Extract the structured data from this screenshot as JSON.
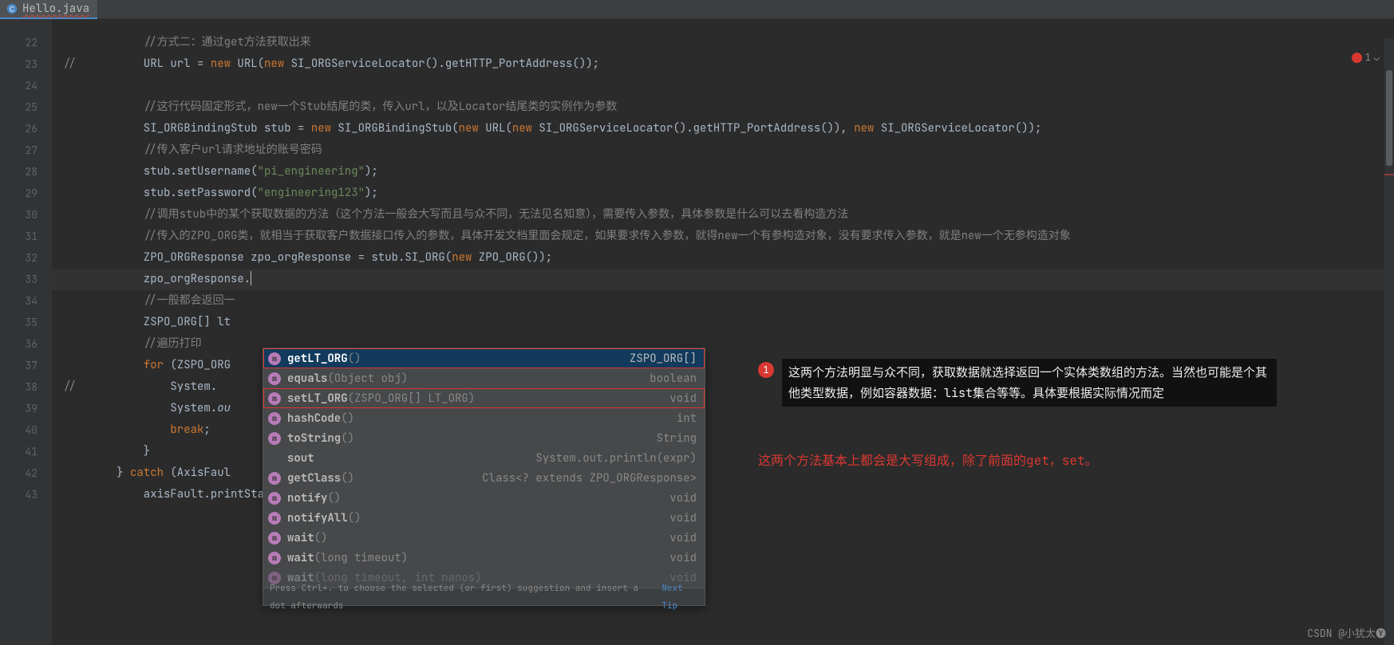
{
  "tab": {
    "filename": "Hello.java"
  },
  "gutter_start": 22,
  "err_count": "1",
  "lines": [
    {
      "n": 22,
      "html": "            <span class='c-comment'>//方式二：通过get方法获取出来</span>"
    },
    {
      "n": 23,
      "html": "<span class='c-comment'>//</span>          URL url = <span class='c-kw'>new</span> URL(<span class='c-kw'>new</span> SI_ORGServiceLocator().getHTTP_PortAddress());"
    },
    {
      "n": 24,
      "html": ""
    },
    {
      "n": 25,
      "html": "            <span class='c-comment'>//这行代码固定形式，new一个Stub结尾的类，传入url，以及Locator结尾类的实例作为参数</span>"
    },
    {
      "n": 26,
      "html": "            SI_ORGBindingStub stub = <span class='c-kw'>new</span> SI_ORGBindingStub(<span class='c-kw'>new</span> URL(<span class='c-kw'>new</span> SI_ORGServiceLocator().getHTTP_PortAddress()), <span class='c-kw'>new</span> SI_ORGServiceLocator());"
    },
    {
      "n": 27,
      "html": "            <span class='c-comment'>//传入客户url请求地址的账号密码</span>"
    },
    {
      "n": 28,
      "html": "            stub.setUsername(<span class='c-str'>\"pi_engineering\"</span>);"
    },
    {
      "n": 29,
      "html": "            stub.setPassword(<span class='c-str'>\"engineering123\"</span>);"
    },
    {
      "n": 30,
      "html": "            <span class='c-comment'>//调用stub中的某个获取数据的方法（这个方法一般会大写而且与众不同，无法见名知意），需要传入参数，具体参数是什么可以去看构造方法</span>"
    },
    {
      "n": 31,
      "html": "            <span class='c-comment'>//传入的ZPO_ORG类，就相当于获取客户数据接口传入的参数，具体开发文档里面会规定，如果要求传入参数，就得new一个有参构造对象，没有要求传入参数，就是new一个无参构造对象</span>"
    },
    {
      "n": 32,
      "html": "            ZPO_ORGResponse zpo_orgResponse = stub.SI_ORG(<span class='c-kw'>new</span> ZPO_ORG());"
    },
    {
      "n": 33,
      "html": "            zpo_orgResponse.<span class='caret'></span>",
      "current": true
    },
    {
      "n": 34,
      "html": "            <span class='c-comment'>//一般都会返回一</span>"
    },
    {
      "n": 35,
      "html": "            ZSPO_ORG[] lt"
    },
    {
      "n": 36,
      "html": "            <span class='c-comment'>//遍历打印</span>"
    },
    {
      "n": 37,
      "html": "            <span class='c-kw'>for</span> (ZSPO_ORG"
    },
    {
      "n": 38,
      "html": "<span class='c-comment'>//</span>              System."
    },
    {
      "n": 39,
      "html": "                System.<span class='c-id' style='font-style:italic'>ou</span>"
    },
    {
      "n": 40,
      "html": "                <span class='c-kw'>break</span>;"
    },
    {
      "n": 41,
      "html": "            }"
    },
    {
      "n": 42,
      "html": "        } <span class='c-kw'>catch</span> (AxisFaul"
    },
    {
      "n": 43,
      "html": "            axisFault.printStackTrace();"
    }
  ],
  "completion": {
    "items": [
      {
        "kind": "m",
        "name": "getLT_ORG",
        "sig": "()",
        "ret": "ZSPO_ORG[]",
        "sel": true
      },
      {
        "kind": "m",
        "name": "equals",
        "sig": "(Object obj)",
        "ret": "boolean"
      },
      {
        "kind": "m",
        "name": "setLT_ORG",
        "sig": "(ZSPO_ORG[] LT_ORG)",
        "ret": "void"
      },
      {
        "kind": "m",
        "name": "hashCode",
        "sig": "()",
        "ret": "int"
      },
      {
        "kind": "m",
        "name": "toString",
        "sig": "()",
        "ret": "String"
      },
      {
        "kind": "",
        "name": "sout",
        "sig": "",
        "ret": "System.out.println(expr)"
      },
      {
        "kind": "m",
        "name": "getClass",
        "sig": "()",
        "ret": "Class<? extends ZPO_ORGResponse>"
      },
      {
        "kind": "m",
        "name": "notify",
        "sig": "()",
        "ret": "void"
      },
      {
        "kind": "m",
        "name": "notifyAll",
        "sig": "()",
        "ret": "void"
      },
      {
        "kind": "m",
        "name": "wait",
        "sig": "()",
        "ret": "void"
      },
      {
        "kind": "m",
        "name": "wait",
        "sig": "(long timeout)",
        "ret": "void"
      },
      {
        "kind": "m",
        "name": "wait",
        "sig": "(long timeout, int nanos)",
        "ret": "void",
        "dim": true
      }
    ],
    "hint_prefix": "Press Ctrl+. to choose the selected (or first) suggestion and insert a dot afterwards",
    "hint_link": "Next Tip"
  },
  "annotation": {
    "badge": "1",
    "text": "这两个方法明显与众不同，获取数据就选择返回一个实体类数组的方法。当然也可能是个其他类型数据，例如容器数据：list集合等等。具体要根据实际情况而定",
    "line2": "这两个方法基本上都会是大写组成，除了前面的get，set。"
  },
  "watermark": "CSDN @小犹太🅨"
}
